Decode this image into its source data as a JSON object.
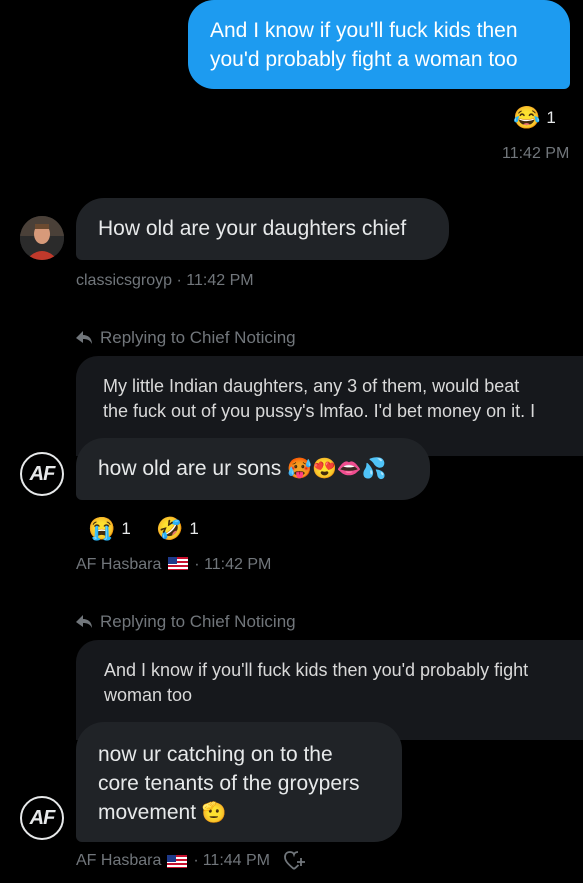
{
  "messages": {
    "m1": {
      "text_line1": "And I know if you'll fuck kids then",
      "text_line2": "you'd probably  fight a woman too",
      "reaction_emoji": "😂",
      "reaction_count": "1",
      "time": "11:42 PM"
    },
    "m2": {
      "text": "How old are your daughters chief",
      "sender": "classicsgroyp",
      "sep": "·",
      "time": "11:42 PM"
    },
    "m3": {
      "replying_to": "Replying to Chief Noticing",
      "quoted_line1": "My little Indian daughters, any 3 of them, would beat",
      "quoted_line2": "the fuck out of you pussy's lmfao. I'd bet money on it. I",
      "text": "how old are ur sons",
      "emojis": "🥵😍👄💦",
      "reactions": [
        {
          "emoji": "😭",
          "count": "1"
        },
        {
          "emoji": "🤣",
          "count": "1"
        }
      ],
      "sender": "AF Hasbara",
      "sep": "·",
      "time": "11:42 PM"
    },
    "m4": {
      "replying_to": "Replying to Chief Noticing",
      "quoted_line1": "And I know if you'll fuck kids then you'd probably  fight",
      "quoted_line2": "woman too",
      "text_line1": "now ur catching on to the",
      "text_line2": "core tenants of the groypers",
      "text_line3": "movement",
      "emoji": "🫡",
      "sender": "AF Hasbara",
      "sep": "·",
      "time": "11:44 PM"
    }
  },
  "avatars": {
    "af_label": "AF"
  },
  "colors": {
    "accent": "#1d9bf0",
    "bubble": "#202327",
    "meta": "#71767b"
  },
  "icons": [
    "reply-arrow-icon",
    "react-heart-plus-icon",
    "us-flag-icon"
  ]
}
